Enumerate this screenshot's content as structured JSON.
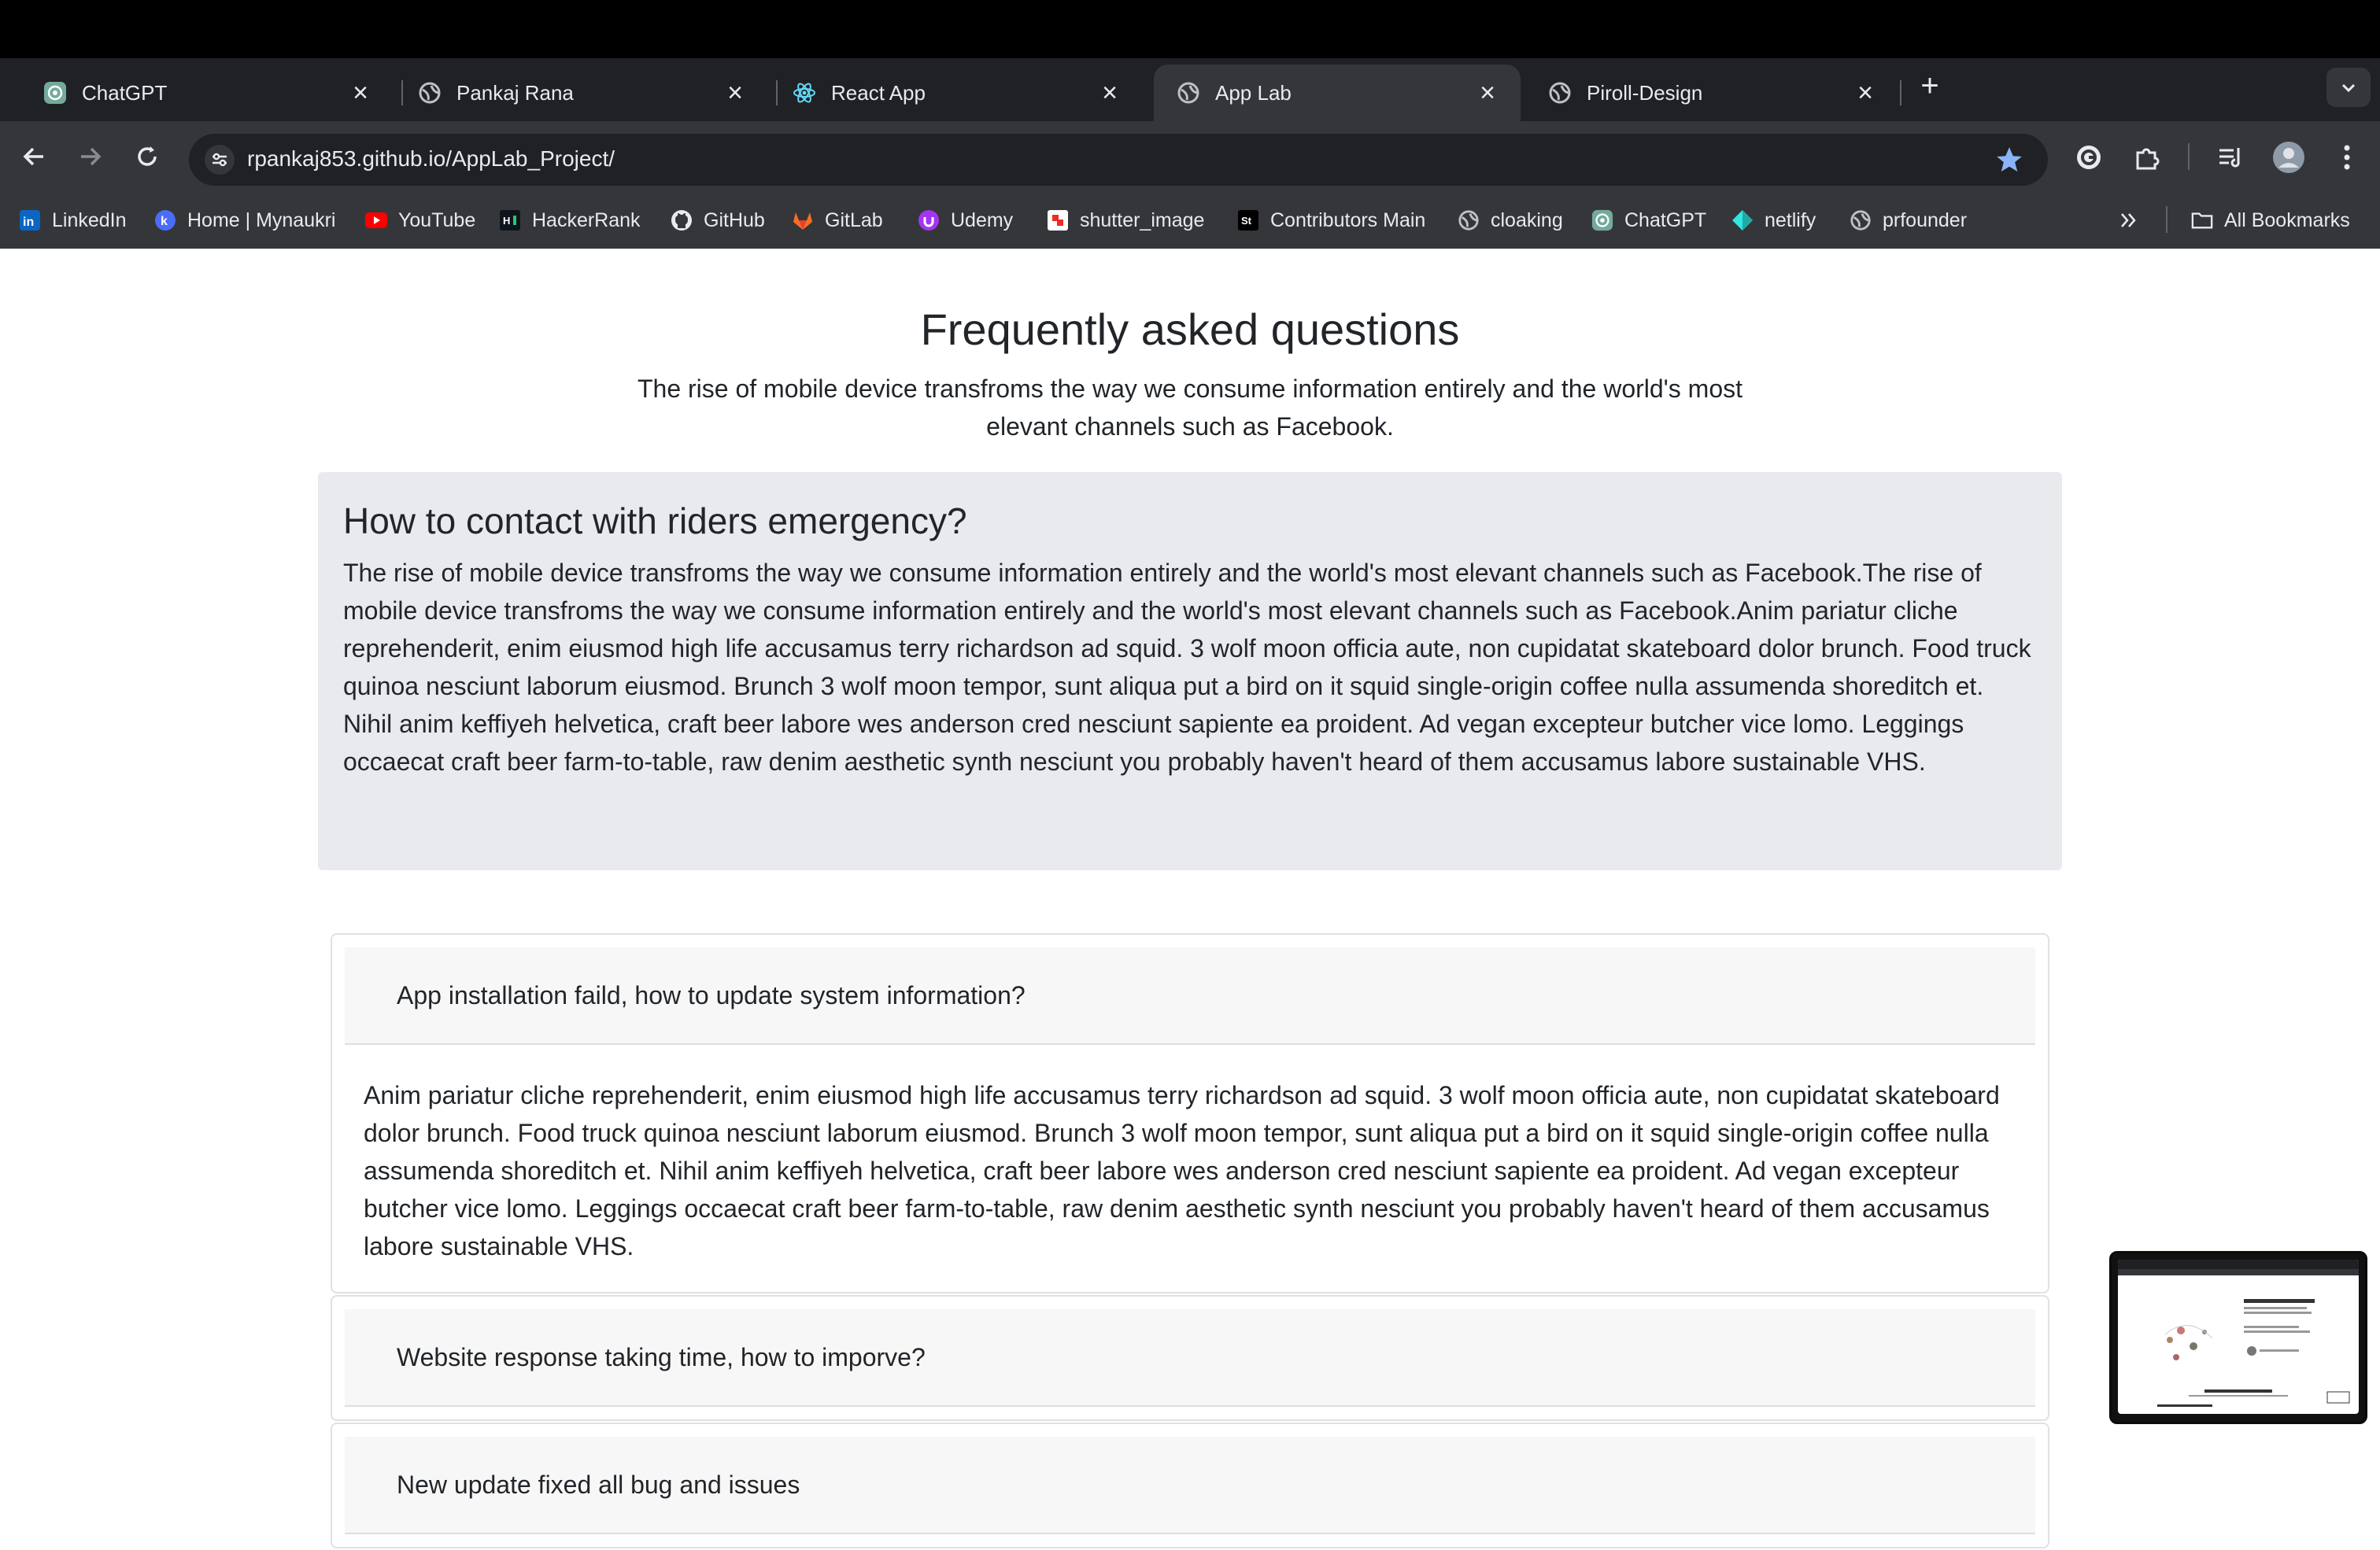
{
  "browser": {
    "tabs": [
      {
        "title": "ChatGPT",
        "icon": "chatgpt-icon",
        "active": false
      },
      {
        "title": "Pankaj Rana",
        "icon": "globe-icon",
        "active": false
      },
      {
        "title": "React App",
        "icon": "react-icon",
        "active": false
      },
      {
        "title": "App Lab",
        "icon": "globe-icon",
        "active": true
      },
      {
        "title": "Piroll-Design",
        "icon": "globe-icon",
        "active": false
      }
    ],
    "url": "rpankaj853.github.io/AppLab_Project/",
    "bookmarks": [
      {
        "label": "LinkedIn",
        "icon": "linkedin-icon"
      },
      {
        "label": "Home | Mynaukri",
        "icon": "mynaukri-icon"
      },
      {
        "label": "YouTube",
        "icon": "youtube-icon"
      },
      {
        "label": "HackerRank",
        "icon": "hackerrank-icon"
      },
      {
        "label": "GitHub",
        "icon": "github-icon"
      },
      {
        "label": "GitLab",
        "icon": "gitlab-icon"
      },
      {
        "label": "Udemy",
        "icon": "udemy-icon"
      },
      {
        "label": "shutter_image",
        "icon": "shutter-icon"
      },
      {
        "label": "Contributors Main",
        "icon": "st-icon"
      },
      {
        "label": "cloaking",
        "icon": "globe-icon"
      },
      {
        "label": "ChatGPT",
        "icon": "chatgpt-icon"
      },
      {
        "label": "netlify",
        "icon": "netlify-icon"
      },
      {
        "label": "prfounder",
        "icon": "globe-icon"
      }
    ],
    "all_bookmarks_label": "All Bookmarks"
  },
  "faq": {
    "title": "Frequently asked questions",
    "subtitle": "The rise of mobile device transfroms the way we consume information entirely and the world's most elevant channels such as Facebook.",
    "featured": {
      "question": "How to contact with riders emergency?",
      "answer": "The rise of mobile device transfroms the way we consume information entirely and the world's most elevant channels such as Facebook.The rise of mobile device transfroms the way we consume information entirely and the world's most elevant channels such as Facebook.Anim pariatur cliche reprehenderit, enim eiusmod high life accusamus terry richardson ad squid. 3 wolf moon officia aute, non cupidatat skateboard dolor brunch. Food truck quinoa nesciunt laborum eiusmod. Brunch 3 wolf moon tempor, sunt aliqua put a bird on it squid single-origin coffee nulla assumenda shoreditch et. Nihil anim keffiyeh helvetica, craft beer labore wes anderson cred nesciunt sapiente ea proident. Ad vegan excepteur butcher vice lomo. Leggings occaecat craft beer farm-to-table, raw denim aesthetic synth nesciunt you probably haven't heard of them accusamus labore sustainable VHS."
    },
    "items": [
      {
        "question": "App installation faild, how to update system information?",
        "answer": "Anim pariatur cliche reprehenderit, enim eiusmod high life accusamus terry richardson ad squid. 3 wolf moon officia aute, non cupidatat skateboard dolor brunch. Food truck quinoa nesciunt laborum eiusmod. Brunch 3 wolf moon tempor, sunt aliqua put a bird on it squid single-origin coffee nulla assumenda shoreditch et. Nihil anim keffiyeh helvetica, craft beer labore wes anderson cred nesciunt sapiente ea proident. Ad vegan excepteur butcher vice lomo. Leggings occaecat craft beer farm-to-table, raw denim aesthetic synth nesciunt you probably haven't heard of them accusamus labore sustainable VHS."
      },
      {
        "question": "Website response taking time, how to imporve?"
      },
      {
        "question": "New update fixed all bug and issues"
      }
    ]
  },
  "colors": {
    "chrome_dark": "#202124",
    "chrome_mid": "#35363a",
    "star_blue": "#8ab4f8",
    "featured_bg": "#e9eaee"
  }
}
